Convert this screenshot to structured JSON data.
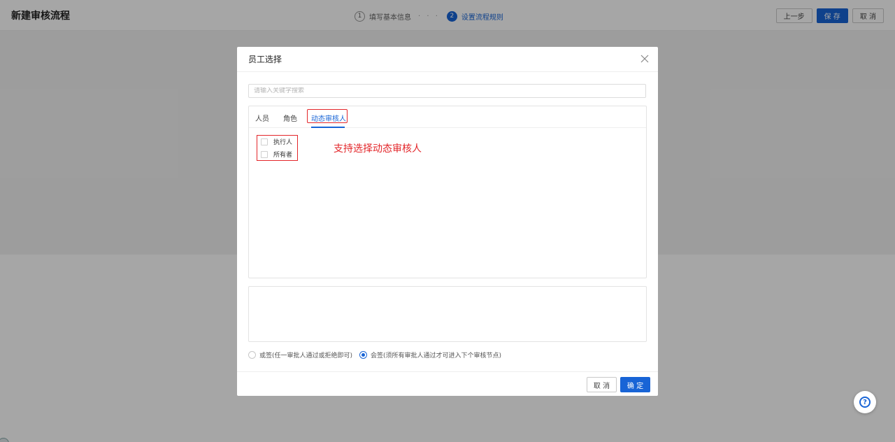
{
  "page": {
    "title": "新建审核流程",
    "steps": [
      {
        "num": "1",
        "label": "填写基本信息"
      },
      {
        "num": "2",
        "label": "设置流程规则"
      }
    ],
    "step_separator": "· · ·",
    "actions": {
      "prev": "上一步",
      "save": "保 存",
      "cancel": "取 消"
    }
  },
  "modal": {
    "title": "员工选择",
    "search_placeholder": "请输入关键字搜索",
    "tabs": [
      "人员",
      "角色",
      "动态审核人"
    ],
    "options": [
      "执行人",
      "所有者"
    ],
    "annotation": "支持选择动态审核人",
    "radios": [
      {
        "label": "或签(任一审批人通过或拒绝即可)",
        "checked": false
      },
      {
        "label": "会签(须所有审批人通过才可进入下个审核节点)",
        "checked": true
      }
    ],
    "footer": {
      "cancel": "取 消",
      "confirm": "确 定"
    }
  },
  "help": {
    "symbol": "?"
  },
  "colors": {
    "primary": "#1864d6",
    "annotation": "#e3262a"
  }
}
